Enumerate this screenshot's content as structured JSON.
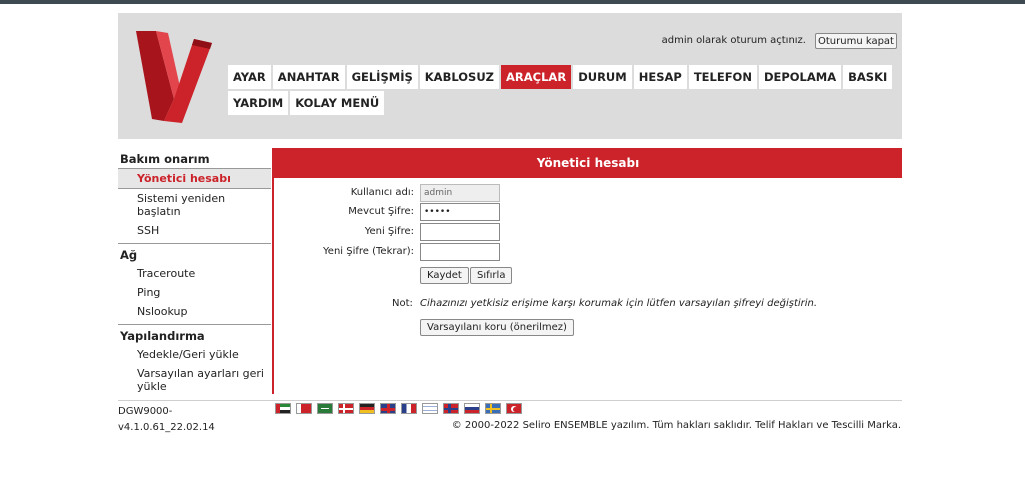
{
  "header": {
    "login_text": "admin olarak oturum açtınız.",
    "logout_label": "Oturumu kapat"
  },
  "nav": {
    "row1": [
      "AYAR",
      "ANAHTAR",
      "GELİŞMİŞ",
      "KABLOSUZ",
      "ARAÇLAR",
      "DURUM",
      "HESAP",
      "TELEFON",
      "DEPOLAMA",
      "BASKI"
    ],
    "row2": [
      "YARDIM",
      "KOLAY MENÜ"
    ],
    "active": "ARAÇLAR"
  },
  "sidebar": {
    "sections": [
      {
        "title": "Bakım onarım",
        "items": [
          "Yönetici hesabı",
          "Sistemi yeniden başlatın",
          "SSH"
        ]
      },
      {
        "title": "Ağ",
        "items": [
          "Traceroute",
          "Ping",
          "Nslookup"
        ]
      },
      {
        "title": "Yapılandırma",
        "items": [
          "Yedekle/Geri yükle",
          "Varsayılan ayarları geri yükle"
        ]
      }
    ],
    "active_item": "Yönetici hesabı"
  },
  "panel": {
    "title": "Yönetici hesabı",
    "fields": {
      "username_label": "Kullanıcı adı:",
      "username_value": "admin",
      "current_password_label": "Mevcut Şifre:",
      "current_password_value": "•••••",
      "new_password_label": "Yeni Şifre:",
      "new_password_repeat_label": "Yeni Şifre (Tekrar):"
    },
    "save_label": "Kaydet",
    "reset_label": "Sıfırla",
    "note_label": "Not:",
    "note_text": "Cihazınızı yetkisiz erişime karşı korumak için lütfen varsayılan şifreyi değiştirin.",
    "keep_default_label": "Varsayılanı koru (önerilmez)"
  },
  "footer": {
    "model": "DGW9000-",
    "version": "v4.1.0.61_22.02.14",
    "copyright": "© 2000-2022 Seliro ENSEMBLE yazılım. Tüm hakları saklıdır. Telif Hakları ve Tescilli Marka.",
    "flags": [
      "ae-flag-icon",
      "bh-flag-icon",
      "sa-flag-icon",
      "dk-flag-icon",
      "de-flag-icon",
      "gb-flag-icon",
      "fr-flag-icon",
      "il-flag-icon",
      "no-flag-icon",
      "ru-flag-icon",
      "se-flag-icon",
      "tr-flag-icon"
    ]
  },
  "colors": {
    "accent": "#cc2229",
    "header_bg": "#dcdcdc"
  }
}
